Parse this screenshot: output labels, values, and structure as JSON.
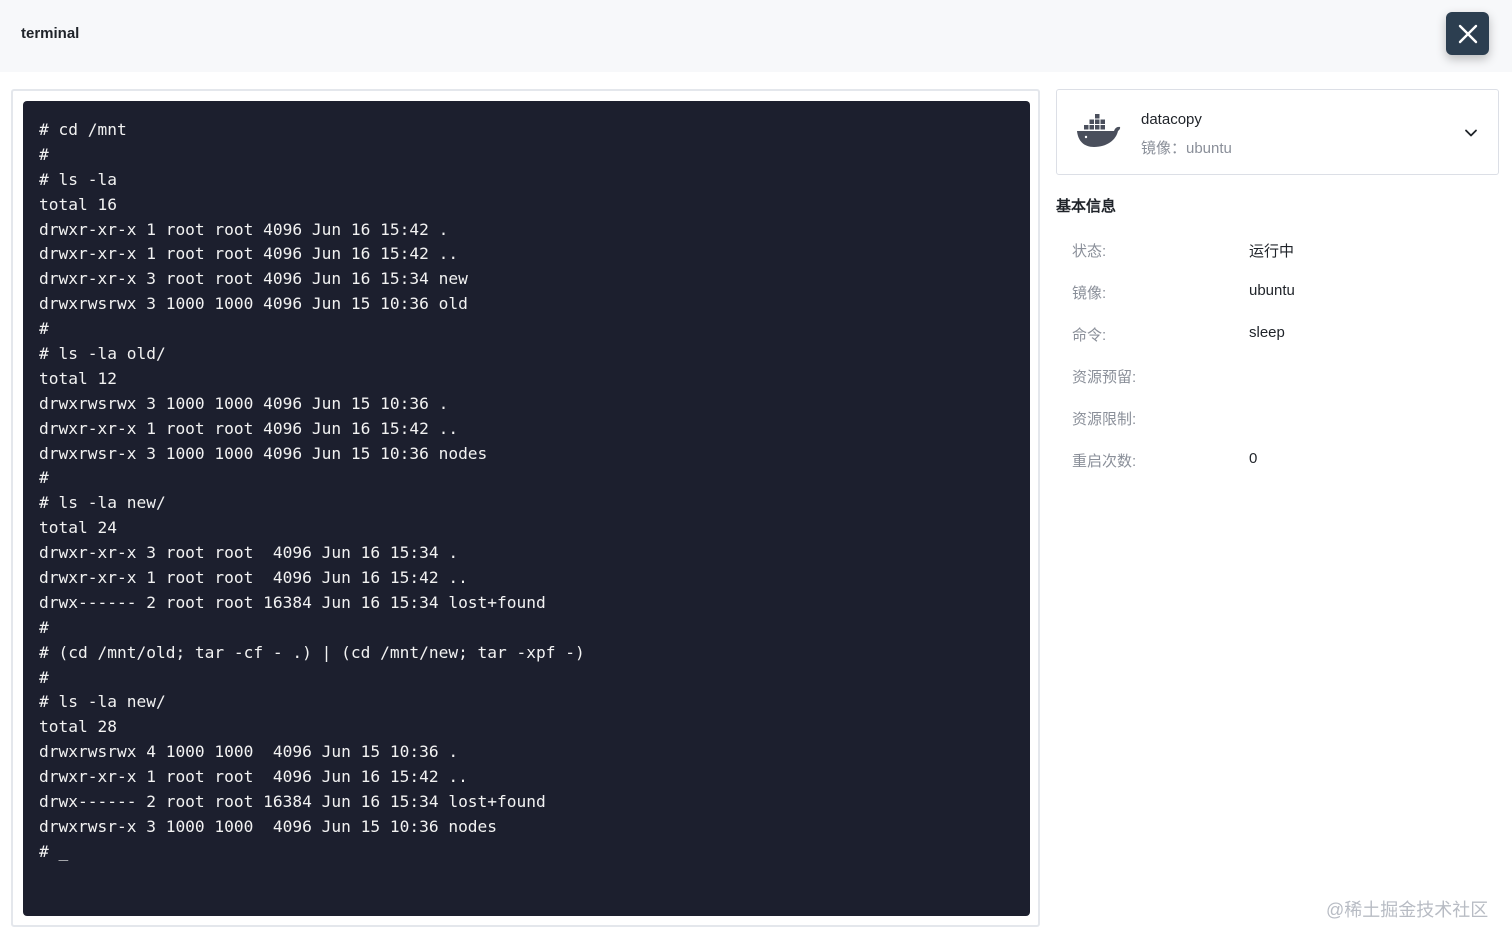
{
  "header": {
    "title": "terminal"
  },
  "terminal": {
    "lines": [
      "# cd /mnt",
      "#",
      "# ls -la",
      "total 16",
      "drwxr-xr-x 1 root root 4096 Jun 16 15:42 .",
      "drwxr-xr-x 1 root root 4096 Jun 16 15:42 ..",
      "drwxr-xr-x 3 root root 4096 Jun 16 15:34 new",
      "drwxrwsrwx 3 1000 1000 4096 Jun 15 10:36 old",
      "#",
      "# ls -la old/",
      "total 12",
      "drwxrwsrwx 3 1000 1000 4096 Jun 15 10:36 .",
      "drwxr-xr-x 1 root root 4096 Jun 16 15:42 ..",
      "drwxrwsr-x 3 1000 1000 4096 Jun 15 10:36 nodes",
      "#",
      "# ls -la new/",
      "total 24",
      "drwxr-xr-x 3 root root  4096 Jun 16 15:34 .",
      "drwxr-xr-x 1 root root  4096 Jun 16 15:42 ..",
      "drwx------ 2 root root 16384 Jun 16 15:34 lost+found",
      "#",
      "# (cd /mnt/old; tar -cf - .) | (cd /mnt/new; tar -xpf -)",
      "#",
      "# ls -la new/",
      "total 28",
      "drwxrwsrwx 4 1000 1000  4096 Jun 15 10:36 .",
      "drwxr-xr-x 1 root root  4096 Jun 16 15:42 ..",
      "drwx------ 2 root root 16384 Jun 16 15:34 lost+found",
      "drwxrwsr-x 3 1000 1000  4096 Jun 15 10:36 nodes",
      "# _"
    ]
  },
  "container": {
    "name": "datacopy",
    "image_text": "镜像：ubuntu",
    "icon": "docker-icon"
  },
  "info": {
    "title": "基本信息",
    "rows": [
      {
        "label": "状态:",
        "value": "运行中"
      },
      {
        "label": "镜像:",
        "value": "ubuntu"
      },
      {
        "label": "命令:",
        "value": "sleep"
      },
      {
        "label": "资源预留:",
        "value": ""
      },
      {
        "label": "资源限制:",
        "value": ""
      },
      {
        "label": "重启次数:",
        "value": "0"
      }
    ]
  },
  "watermark": "@稀土掘金技术社区",
  "colors": {
    "terminal_bg": "#1c1f2e",
    "close_button_bg": "#2c3e50",
    "docker_icon": "#4a4f5c"
  }
}
